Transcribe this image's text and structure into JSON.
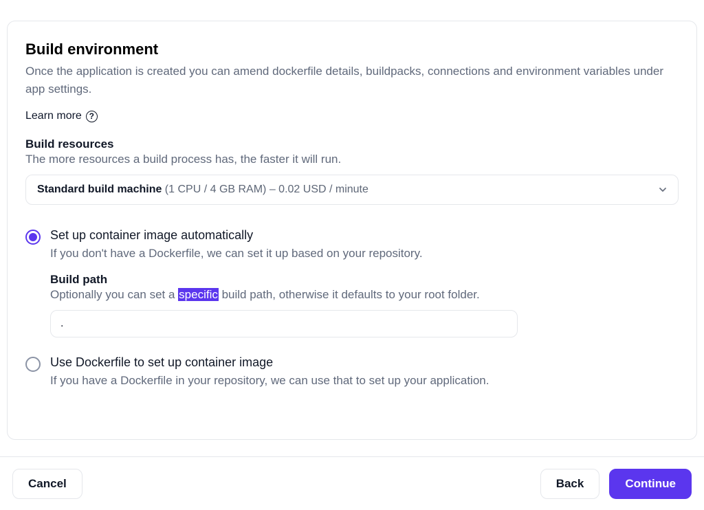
{
  "heading": "Build environment",
  "subheading": "Once the application is created you can amend dockerfile details, buildpacks, connections and environment variables under app settings.",
  "learn_more": "Learn more",
  "build_resources": {
    "label": "Build resources",
    "desc": "The more resources a build process has, the faster it will run.",
    "selected_bold": "Standard build machine",
    "selected_light": " (1 CPU / 4 GB RAM) – 0.02 USD / minute"
  },
  "option_auto": {
    "title": "Set up container image automatically",
    "desc": "If you don't have a Dockerfile, we can set it up based on your repository.",
    "build_path_label": "Build path",
    "build_path_desc_pre": "Optionally you can set a ",
    "build_path_desc_highlight": "specific",
    "build_path_desc_post": " build path, otherwise it defaults to your root folder.",
    "build_path_value": "."
  },
  "option_docker": {
    "title": "Use Dockerfile to set up container image",
    "desc": "If you have a Dockerfile in your repository, we can use that to set up your application."
  },
  "footer": {
    "cancel": "Cancel",
    "back": "Back",
    "continue": "Continue"
  }
}
